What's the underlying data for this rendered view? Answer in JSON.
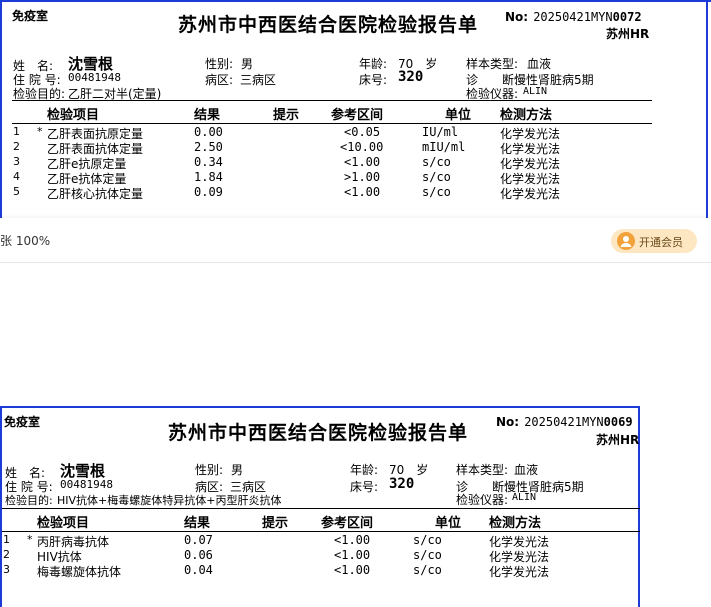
{
  "report1": {
    "stamp": "免疫室",
    "title": "苏州市中西医结合医院检验报告单",
    "no_label": "No:",
    "no_value": "20250421MYN",
    "no_suffix": "0072",
    "hospital_short": "苏州HR",
    "name_label": "姓　名:",
    "name_value": "沈雪根",
    "sex_label": "性别:",
    "sex_value": "男",
    "age_label": "年龄:",
    "age_value": "70　岁",
    "sample_label": "样本类型:",
    "sample_value": "血液",
    "inpatient_label": "住 院 号:",
    "inpatient_value": "00481948",
    "ward_label": "病区:",
    "ward_value": "三病区",
    "bed_label": "床号:",
    "bed_value": "320",
    "diag_label": "诊　　断:",
    "diag_value": "慢性肾脏病5期",
    "purpose_label": "检验目的:",
    "purpose_value": "乙肝二对半(定量)",
    "instrument_label": "检验仪器:",
    "instrument_value": "ALIN",
    "headers": [
      "检验项目",
      "结果",
      "提示",
      "参考区间",
      "单位",
      "检测方法"
    ],
    "rows": [
      {
        "no": "1",
        "mark": "*",
        "item": "乙肝表面抗原定量",
        "result": "0.00",
        "hint": "",
        "ref": "<0.05",
        "unit": "IU/ml",
        "method": "化学发光法"
      },
      {
        "no": "2",
        "mark": "",
        "item": "乙肝表面抗体定量",
        "result": "2.50",
        "hint": "",
        "ref": "<10.00",
        "unit": "mIU/ml",
        "method": "化学发光法"
      },
      {
        "no": "3",
        "mark": "",
        "item": "乙肝e抗原定量",
        "result": "0.34",
        "hint": "",
        "ref": "<1.00",
        "unit": "s/co",
        "method": "化学发光法"
      },
      {
        "no": "4",
        "mark": "",
        "item": "乙肝e抗体定量",
        "result": "1.84",
        "hint": "",
        "ref": ">1.00",
        "unit": "s/co",
        "method": "化学发光法"
      },
      {
        "no": "5",
        "mark": "",
        "item": "乙肝核心抗体定量",
        "result": "0.09",
        "hint": "",
        "ref": "<1.00",
        "unit": "s/co",
        "method": "化学发光法"
      }
    ]
  },
  "viewer": {
    "zoom_text": "张 100%",
    "vip_label": "开通会员",
    "vip_icon": "user-icon",
    "vip_bg": "#fde7c3",
    "vip_icon_color": "#f2a23a"
  },
  "report2": {
    "stamp": "免疫室",
    "title": "苏州市中西医结合医院检验报告单",
    "no_label": "No:",
    "no_value": "20250421MYN",
    "no_suffix": "0069",
    "hospital_short": "苏州HR",
    "name_label": "姓　名:",
    "name_value": "沈雪根",
    "sex_label": "性别:",
    "sex_value": "男",
    "age_label": "年龄:",
    "age_value": "70　岁",
    "sample_label": "样本类型:",
    "sample_value": "血液",
    "inpatient_label": "住 院 号:",
    "inpatient_value": "00481948",
    "ward_label": "病区:",
    "ward_value": "三病区",
    "bed_label": "床号:",
    "bed_value": "320",
    "diag_label": "诊　　断:",
    "diag_value": "慢性肾脏病5期",
    "purpose_label": "检验目的:",
    "purpose_value": "HIV抗体+梅毒螺旋体特异抗体+丙型肝炎抗体",
    "instrument_label": "检验仪器:",
    "instrument_value": "ALIN",
    "headers": [
      "检验项目",
      "结果",
      "提示",
      "参考区间",
      "单位",
      "检测方法"
    ],
    "rows": [
      {
        "no": "1",
        "mark": "*",
        "item": "丙肝病毒抗体",
        "result": "0.07",
        "hint": "",
        "ref": "<1.00",
        "unit": "s/co",
        "method": "化学发光法"
      },
      {
        "no": "2",
        "mark": "",
        "item": "HIV抗体",
        "result": "0.06",
        "hint": "",
        "ref": "<1.00",
        "unit": "s/co",
        "method": "化学发光法"
      },
      {
        "no": "3",
        "mark": "",
        "item": "梅毒螺旋体抗体",
        "result": "0.04",
        "hint": "",
        "ref": "<1.00",
        "unit": "s/co",
        "method": "化学发光法"
      }
    ]
  },
  "colors": {
    "border": "#1d3bd6",
    "text": "#000000"
  }
}
